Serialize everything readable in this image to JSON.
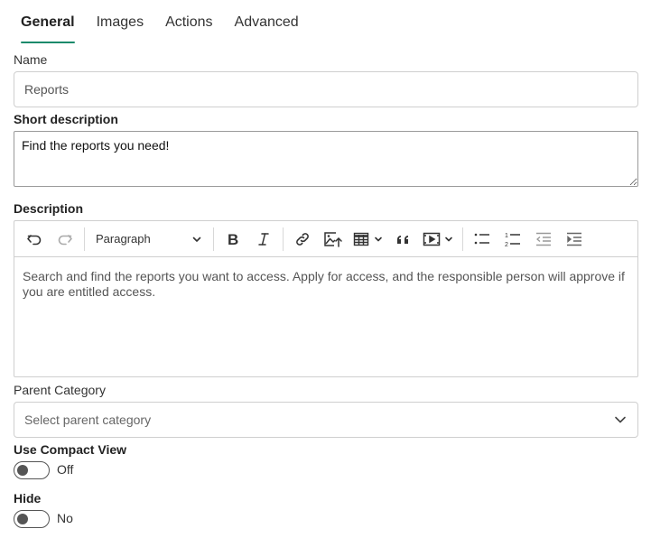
{
  "tabs": [
    {
      "label": "General",
      "active": true
    },
    {
      "label": "Images"
    },
    {
      "label": "Actions"
    },
    {
      "label": "Advanced"
    }
  ],
  "name": {
    "label": "Name",
    "value": "Reports"
  },
  "short_description": {
    "label": "Short description",
    "value": "Find the reports you need!"
  },
  "description": {
    "label": "Description",
    "paragraph_select": "Paragraph",
    "content": "Search and find the reports you want to access. Apply for access, and the responsible person will approve if you are entitled access."
  },
  "parent_category": {
    "label": "Parent Category",
    "placeholder": "Select parent category"
  },
  "compact_view": {
    "label": "Use Compact View",
    "state_text": "Off"
  },
  "hide": {
    "label": "Hide",
    "state_text": "No"
  },
  "colors": {
    "accent": "#1b8a6b",
    "border": "#cfcfcf",
    "text": "#333333"
  },
  "icons": [
    "undo-icon",
    "redo-icon",
    "chevron-down-icon",
    "bold-icon",
    "italic-icon",
    "link-icon",
    "insert-image-icon",
    "table-icon",
    "blockquote-icon",
    "media-embed-icon",
    "bulleted-list-icon",
    "numbered-list-icon",
    "outdent-icon",
    "indent-icon"
  ]
}
